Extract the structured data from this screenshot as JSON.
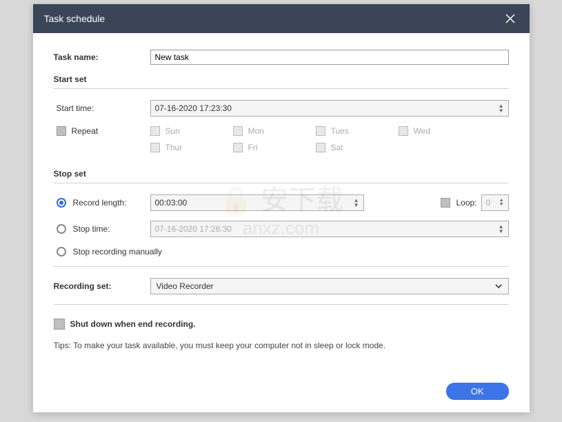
{
  "title": "Task schedule",
  "taskName": {
    "label": "Task name:",
    "value": "New task"
  },
  "startSet": {
    "header": "Start set",
    "startTimeLabel": "Start time:",
    "startTimeValue": "07-16-2020 17:23:30",
    "repeatLabel": "Repeat",
    "days": {
      "sun": "Sun",
      "mon": "Mon",
      "tues": "Tues",
      "wed": "Wed",
      "thur": "Thur",
      "fri": "Fri",
      "sat": "Sat"
    }
  },
  "stopSet": {
    "header": "Stop set",
    "recordLengthLabel": "Record length:",
    "recordLengthValue": "00:03:00",
    "loopLabel": "Loop:",
    "loopValue": "0",
    "stopTimeLabel": "Stop time:",
    "stopTimeValue": "07-16-2020 17:26:30",
    "manualLabel": "Stop recording manually"
  },
  "recordingSet": {
    "label": "Recording set:",
    "value": "Video Recorder"
  },
  "shutdownLabel": "Shut down when end recording.",
  "tips": "Tips: To make your task available, you must keep your computer not in sleep or lock mode.",
  "okLabel": "OK",
  "watermark": "安下载\nanxz.com"
}
